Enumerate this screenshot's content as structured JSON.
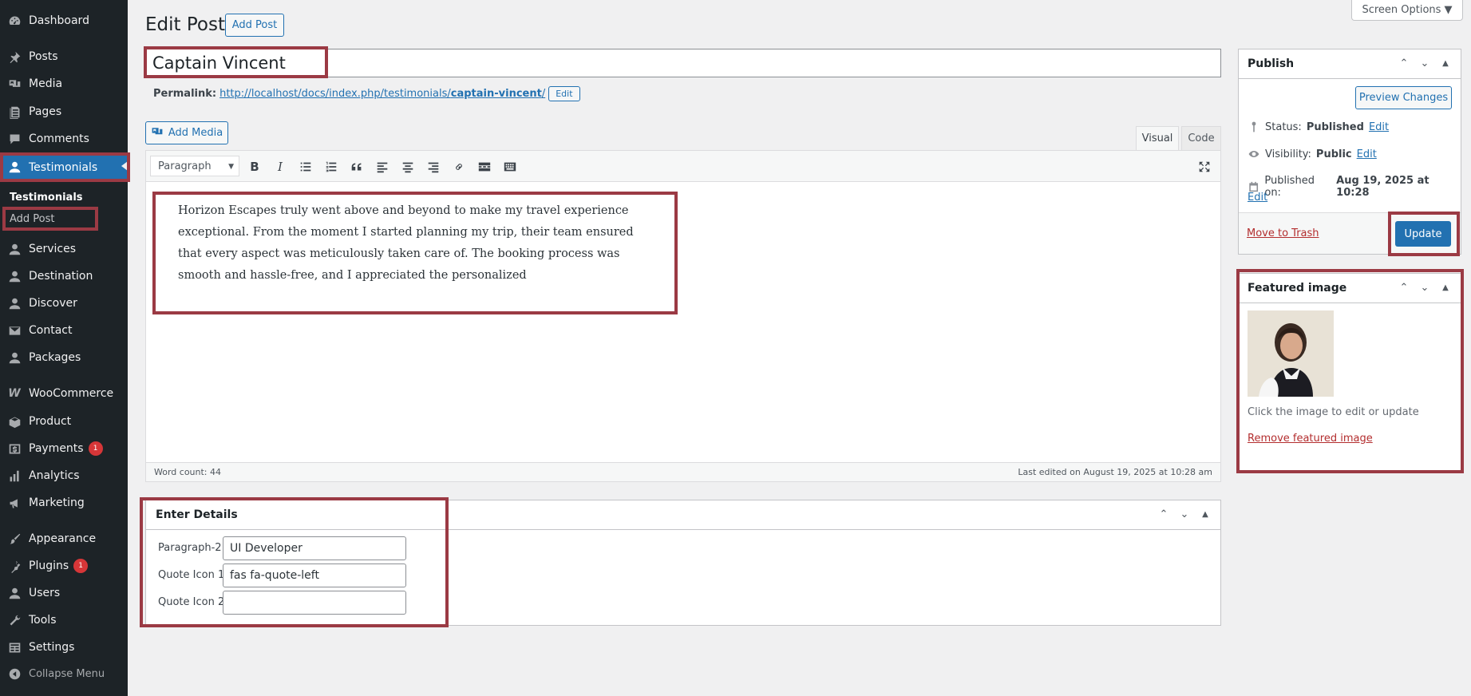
{
  "sidebar": {
    "items": [
      {
        "label": "Dashboard",
        "icon": "dashboard-icon"
      },
      {
        "label": "Posts",
        "icon": "pin-icon"
      },
      {
        "label": "Media",
        "icon": "media-icon"
      },
      {
        "label": "Pages",
        "icon": "pages-icon"
      },
      {
        "label": "Comments",
        "icon": "comment-icon"
      },
      {
        "label": "Testimonials",
        "icon": "user-icon"
      },
      {
        "label": "Services",
        "icon": "user-icon"
      },
      {
        "label": "Destination",
        "icon": "user-icon"
      },
      {
        "label": "Discover",
        "icon": "user-icon"
      },
      {
        "label": "Contact",
        "icon": "envelope-icon"
      },
      {
        "label": "Packages",
        "icon": "user-icon"
      },
      {
        "label": "WooCommerce",
        "icon": "woo-icon"
      },
      {
        "label": "Product",
        "icon": "product-icon"
      },
      {
        "label": "Payments",
        "icon": "payments-icon",
        "badge": "1"
      },
      {
        "label": "Analytics",
        "icon": "analytics-icon"
      },
      {
        "label": "Marketing",
        "icon": "megaphone-icon"
      },
      {
        "label": "Appearance",
        "icon": "brush-icon"
      },
      {
        "label": "Plugins",
        "icon": "plugin-icon",
        "badge": "1"
      },
      {
        "label": "Users",
        "icon": "user-icon"
      },
      {
        "label": "Tools",
        "icon": "wrench-icon"
      },
      {
        "label": "Settings",
        "icon": "settings-icon"
      }
    ],
    "submenu": [
      "Testimonials",
      "Add Post"
    ],
    "collapse_label": "Collapse Menu"
  },
  "header": {
    "title": "Edit Post",
    "add_post_label": "Add Post",
    "screen_options_label": "Screen Options ▼"
  },
  "post": {
    "title": "Captain Vincent",
    "permalink_label": "Permalink:",
    "permalink_base": "http://localhost/docs/index.php/testimonials/",
    "permalink_slug": "captain-vincent",
    "permalink_trailing": "/",
    "permalink_edit": "Edit"
  },
  "editor": {
    "add_media_label": "Add Media",
    "tab_visual": "Visual",
    "tab_code": "Code",
    "format_value": "Paragraph",
    "content": "Horizon Escapes truly went above and beyond to make my travel experience exceptional. From the moment I started planning my trip, their team ensured that every aspect was meticulously taken care of. The booking process was smooth and hassle-free, and I appreciated the personalized",
    "word_count": "Word count: 44",
    "last_edited": "Last edited on August 19, 2025 at 10:28 am"
  },
  "details": {
    "title": "Enter Details",
    "fields": [
      {
        "label": "Paragraph-2",
        "value": "UI Developer"
      },
      {
        "label": "Quote Icon 1",
        "value": "fas fa-quote-left"
      },
      {
        "label": "Quote Icon 2",
        "value": ""
      }
    ]
  },
  "publish": {
    "title": "Publish",
    "preview_label": "Preview Changes",
    "status_label": "Status:",
    "status_value": "Published",
    "visibility_label": "Visibility:",
    "visibility_value": "Public",
    "published_label": "Published on:",
    "published_value": "Aug 19, 2025 at 10:28",
    "edit_label": "Edit",
    "trash_label": "Move to Trash",
    "update_label": "Update"
  },
  "featured": {
    "title": "Featured image",
    "help": "Click the image to edit or update",
    "remove_label": "Remove featured image"
  },
  "colors": {
    "sidebar_bg": "#1d2327",
    "accent": "#2271b1",
    "highlight": "#9b3a44",
    "danger": "#b32d2e"
  }
}
